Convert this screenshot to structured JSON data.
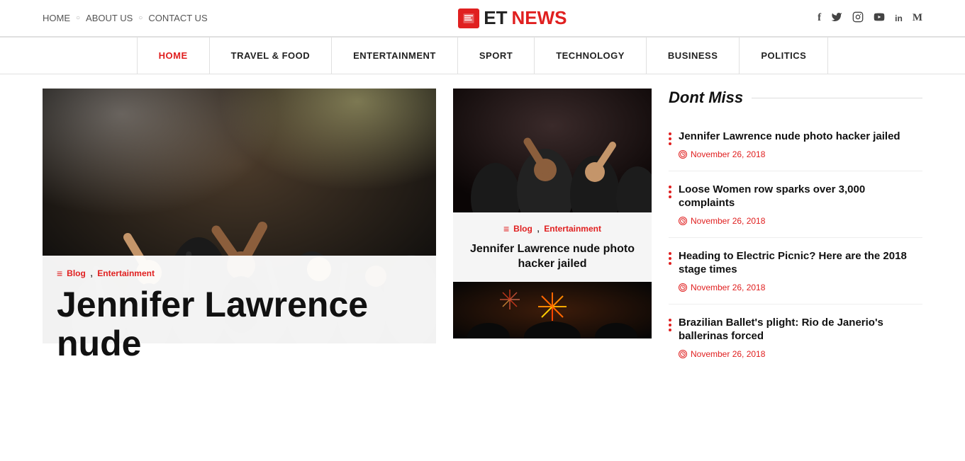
{
  "topNav": {
    "home": "HOME",
    "about": "ABOUT US",
    "contact": "CONTACT US"
  },
  "logo": {
    "prefix": "ET",
    "suffix": "NEWS"
  },
  "socialIcons": [
    {
      "name": "facebook",
      "symbol": "f"
    },
    {
      "name": "twitter",
      "symbol": "t"
    },
    {
      "name": "instagram",
      "symbol": "i"
    },
    {
      "name": "youtube",
      "symbol": "▶"
    },
    {
      "name": "linkedin",
      "symbol": "in"
    },
    {
      "name": "medium",
      "symbol": "M"
    }
  ],
  "mainNav": [
    {
      "label": "HOME",
      "active": true
    },
    {
      "label": "TRAVEL & FOOD",
      "active": false
    },
    {
      "label": "ENTERTAINMENT",
      "active": false
    },
    {
      "label": "SPORT",
      "active": false
    },
    {
      "label": "TECHNOLOGY",
      "active": false
    },
    {
      "label": "BUSINESS",
      "active": false
    },
    {
      "label": "POLITICS",
      "active": false
    }
  ],
  "featuredArticle": {
    "tag1": "Blog",
    "tag2": "Entertainment",
    "title": "Jennifer Lawrence nude"
  },
  "middleArticle1": {
    "tag1": "Blog",
    "tag2": "Entertainment",
    "title": "Jennifer Lawrence nude photo hacker jailed"
  },
  "sidebar": {
    "sectionTitle": "Dont Miss",
    "items": [
      {
        "title": "Jennifer Lawrence nude photo hacker jailed",
        "date": "November 26, 2018"
      },
      {
        "title": "Loose Women row sparks over 3,000 complaints",
        "date": "November 26, 2018"
      },
      {
        "title": "Heading to Electric Picnic? Here are the 2018 stage times",
        "date": "November 26, 2018"
      },
      {
        "title": "Brazilian Ballet's plight: Rio de Janerio's ballerinas forced",
        "date": "November 26, 2018"
      }
    ]
  }
}
